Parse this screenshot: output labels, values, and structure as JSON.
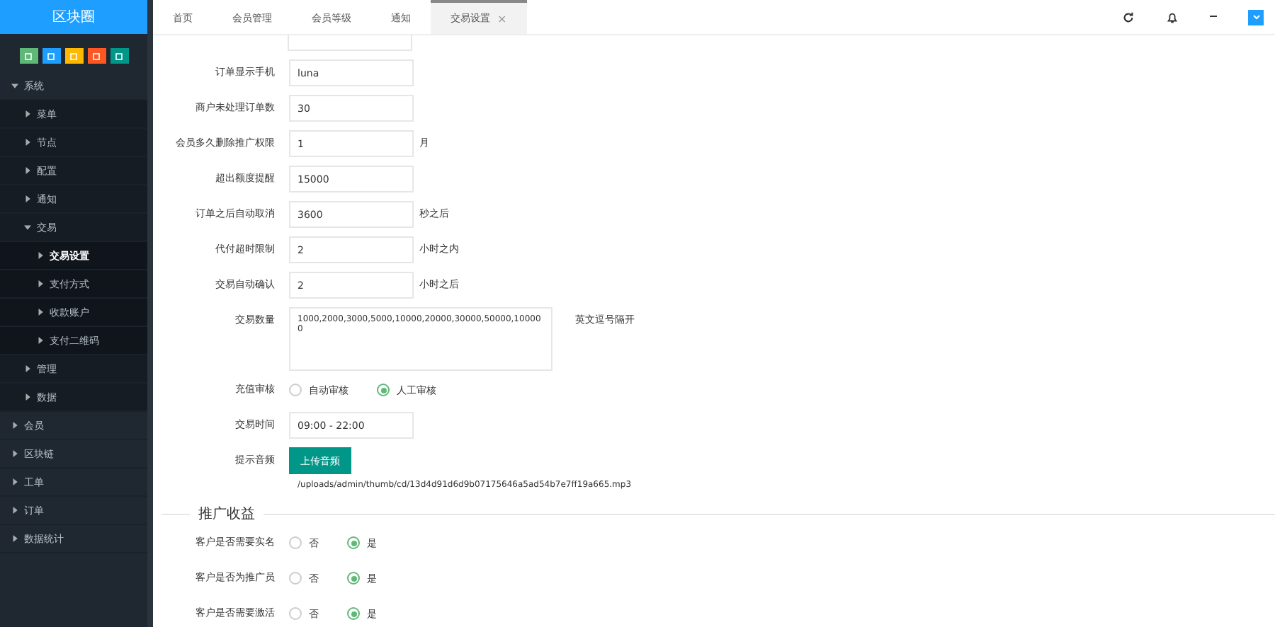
{
  "logo": "区块圈",
  "sidebar": {
    "items": [
      {
        "label": "系统",
        "expanded": true,
        "selected": false,
        "children": [
          {
            "label": "菜单",
            "expanded": false,
            "selected": false
          },
          {
            "label": "节点",
            "expanded": false,
            "selected": false
          },
          {
            "label": "配置",
            "expanded": false,
            "selected": false
          },
          {
            "label": "通知",
            "expanded": false,
            "selected": false
          },
          {
            "label": "交易",
            "expanded": true,
            "selected": false,
            "children": [
              {
                "label": "交易设置",
                "expanded": false,
                "selected": true
              },
              {
                "label": "支付方式",
                "expanded": false,
                "selected": false
              },
              {
                "label": "收款账户",
                "expanded": false,
                "selected": false
              },
              {
                "label": "支付二维码",
                "expanded": false,
                "selected": false
              }
            ]
          },
          {
            "label": "管理",
            "expanded": false,
            "selected": false
          },
          {
            "label": "数据",
            "expanded": false,
            "selected": false
          }
        ]
      },
      {
        "label": "会员",
        "expanded": false,
        "selected": false
      },
      {
        "label": "区块链",
        "expanded": false,
        "selected": false
      },
      {
        "label": "工单",
        "expanded": false,
        "selected": false
      },
      {
        "label": "订单",
        "expanded": false,
        "selected": false
      },
      {
        "label": "数据统计",
        "expanded": false,
        "selected": false
      }
    ]
  },
  "tabs": [
    {
      "label": "首页",
      "selected": false
    },
    {
      "label": "会员管理",
      "selected": false
    },
    {
      "label": "会员等级",
      "selected": false
    },
    {
      "label": "通知",
      "selected": false
    },
    {
      "label": "交易设置",
      "selected": true,
      "close": "×"
    }
  ],
  "form": [
    {
      "kind": "input",
      "label": "订单显示手机",
      "value": "luna"
    },
    {
      "kind": "input",
      "label": "商户未处理订单数",
      "value": "30"
    },
    {
      "kind": "input",
      "label": "会员多久删除推广权限",
      "value": "1",
      "suffix": "月"
    },
    {
      "kind": "input",
      "label": "超出额度提醒",
      "value": "15000"
    },
    {
      "kind": "input",
      "label": "订单之后自动取消",
      "value": "3600",
      "suffix": "秒之后"
    },
    {
      "kind": "input",
      "label": "代付超时限制",
      "value": "2",
      "suffix": "小时之内"
    },
    {
      "kind": "input",
      "label": "交易自动确认",
      "value": "2",
      "suffix": "小时之后"
    },
    {
      "kind": "textarea",
      "label": "交易数量",
      "value": "1000,2000,3000,5000,10000,20000,30000,50000,100000",
      "suffix": "英文逗号隔开"
    },
    {
      "kind": "radio",
      "label": "充值审核",
      "options": [
        {
          "label": "自动审核",
          "selected": false
        },
        {
          "label": "人工审核",
          "selected": true
        }
      ]
    },
    {
      "kind": "input",
      "label": "交易时间",
      "value": "09:00 - 22:00"
    },
    {
      "kind": "upload",
      "label": "提示音频",
      "button": "上传音频",
      "path": "/uploads/admin/thumb/cd/13d4d91d6d9b07175646a5ad54b7e7ff19a665.mp3"
    }
  ],
  "section": {
    "title": "推广收益",
    "rows": [
      {
        "label": "客户是否需要实名",
        "options": [
          {
            "label": "否",
            "selected": false
          },
          {
            "label": "是",
            "selected": true
          }
        ]
      },
      {
        "label": "客户是否为推广员",
        "options": [
          {
            "label": "否",
            "selected": false
          },
          {
            "label": "是",
            "selected": true
          }
        ]
      },
      {
        "label": "客户是否需要激活",
        "options": [
          {
            "label": "否",
            "selected": false
          },
          {
            "label": "是",
            "selected": true
          }
        ]
      }
    ]
  }
}
